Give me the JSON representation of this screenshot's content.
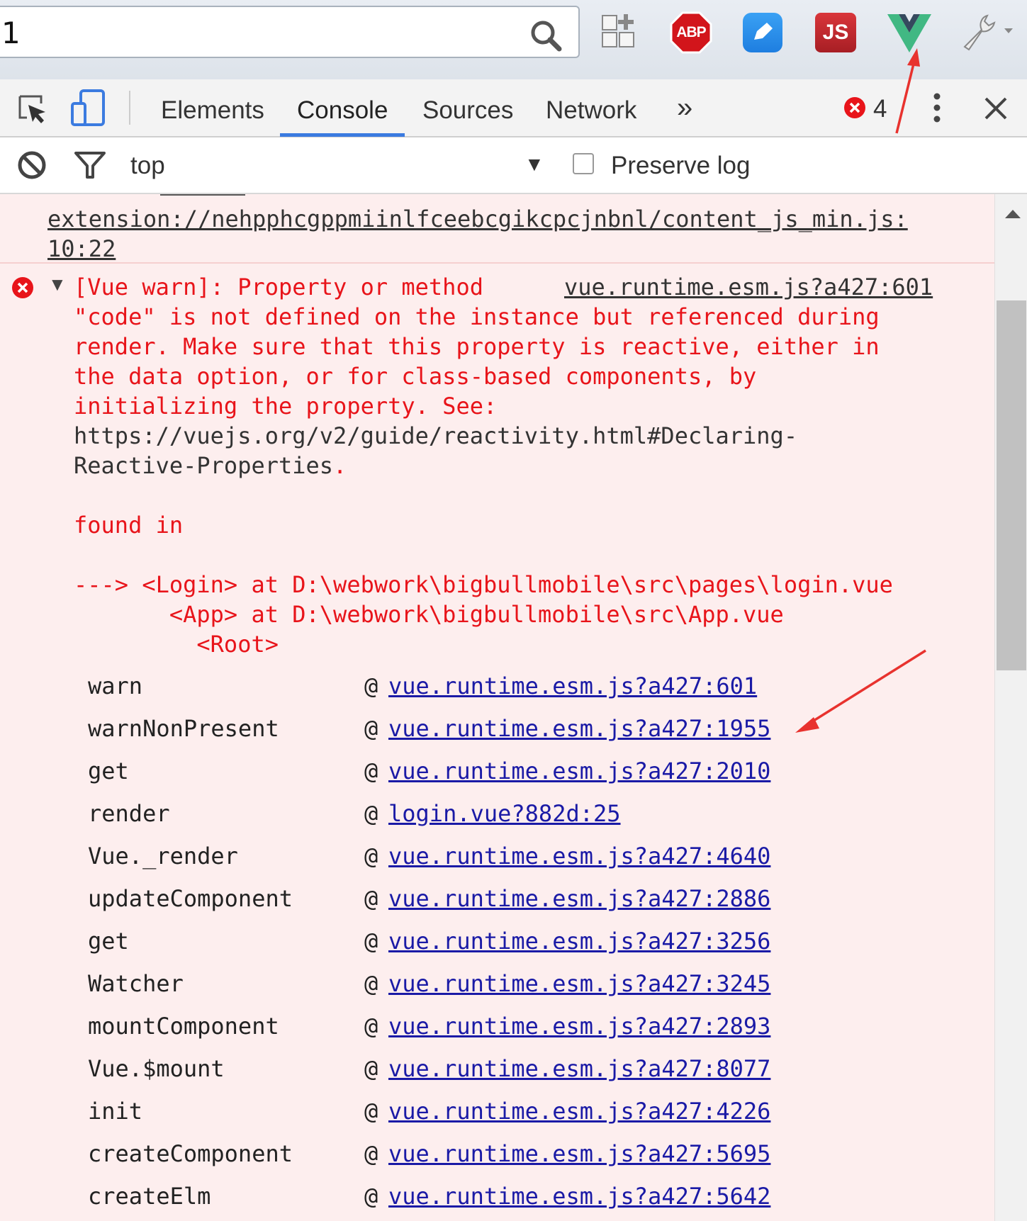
{
  "browser": {
    "omnibox_text": "1",
    "extensions": [
      {
        "name": "apps-icon"
      },
      {
        "name": "abp-icon",
        "label": "ABP"
      },
      {
        "name": "blue-pen-icon"
      },
      {
        "name": "js-icon",
        "label": "JS"
      },
      {
        "name": "vue-devtools-icon"
      },
      {
        "name": "wrench-icon"
      }
    ]
  },
  "devtools": {
    "tabs": [
      "Elements",
      "Console",
      "Sources",
      "Network"
    ],
    "more_tabs": "»",
    "active_tab": "Console",
    "error_count": "4"
  },
  "console_toolbar": {
    "context": "top",
    "preserve_log_label": "Preserve log",
    "preserve_log_checked": false
  },
  "console": {
    "previous_link": "extension://nehpphcgppmiinlfceebcgikcpcjnbnl/content_js_min.js:\n10:22",
    "message": {
      "source": "vue.runtime.esm.js?a427:601",
      "line1": "[Vue warn]: Property or method",
      "line2": "\"code\" is not defined on the instance but referenced during",
      "line3": "render. Make sure that this property is reactive, either in",
      "line4": "the data option, or for class-based components, by",
      "line5": "initializing the property. See:",
      "url_line1": "https://vuejs.org/v2/guide/reactivity.html#Declaring-",
      "url_line2": "Reactive-Properties",
      "url_tail": ".",
      "found_in": "found in",
      "trace1": "---> <Login> at D:\\webwork\\bigbullmobile\\src\\pages\\login.vue",
      "trace2": "       <App> at D:\\webwork\\bigbullmobile\\src\\App.vue",
      "trace3": "         <Root>"
    },
    "stack": [
      {
        "fn": "warn",
        "link": "vue.runtime.esm.js?a427:601"
      },
      {
        "fn": "warnNonPresent",
        "link": "vue.runtime.esm.js?a427:1955"
      },
      {
        "fn": "get",
        "link": "vue.runtime.esm.js?a427:2010"
      },
      {
        "fn": "render",
        "link": "login.vue?882d:25"
      },
      {
        "fn": "Vue._render",
        "link": "vue.runtime.esm.js?a427:4640"
      },
      {
        "fn": "updateComponent",
        "link": "vue.runtime.esm.js?a427:2886"
      },
      {
        "fn": "get",
        "link": "vue.runtime.esm.js?a427:3256"
      },
      {
        "fn": "Watcher",
        "link": "vue.runtime.esm.js?a427:3245"
      },
      {
        "fn": "mountComponent",
        "link": "vue.runtime.esm.js?a427:2893"
      },
      {
        "fn": "Vue.$mount",
        "link": "vue.runtime.esm.js?a427:8077"
      },
      {
        "fn": "init",
        "link": "vue.runtime.esm.js?a427:4226"
      },
      {
        "fn": "createComponent",
        "link": "vue.runtime.esm.js?a427:5695"
      },
      {
        "fn": "createElm",
        "link": "vue.runtime.esm.js?a427:5642"
      }
    ],
    "stack_at": "@"
  },
  "colors": {
    "error_text": "#e8141a",
    "link": "#1a1aa6",
    "annotation_arrow": "#e8322e",
    "vue_green": "#41b883",
    "vue_dark": "#35495e"
  }
}
